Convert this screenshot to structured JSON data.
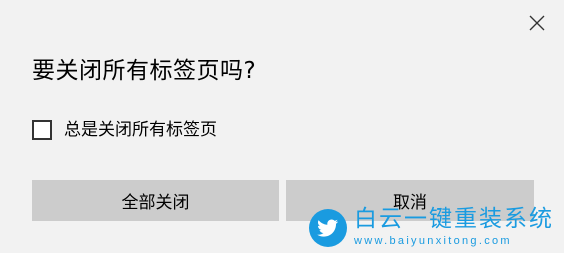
{
  "dialog": {
    "title": "要关闭所有标签页吗?",
    "checkbox_label": "总是关闭所有标签页",
    "checkbox_checked": false,
    "close_all_label": "全部关闭",
    "cancel_label": "取消",
    "close_icon": "close-icon"
  },
  "watermark": {
    "name": "白云一键重装系统",
    "url": "www.baiyunxitong.com",
    "logo_icon": "twitter-bird-icon"
  },
  "colors": {
    "dialog_background": "#f2f2f2",
    "button_background": "#cccccc",
    "checkbox_border": "#333333",
    "watermark_blue": "#1a9be0"
  }
}
